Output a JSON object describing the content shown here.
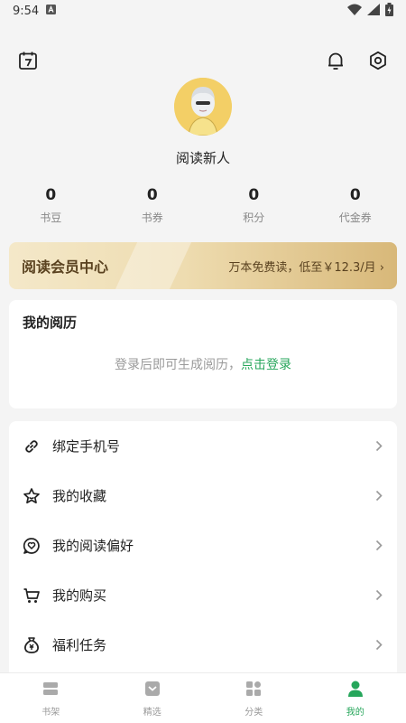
{
  "status_bar": {
    "time": "9:54"
  },
  "profile": {
    "nickname": "阅读新人"
  },
  "stats": [
    {
      "value": "0",
      "label": "书豆"
    },
    {
      "value": "0",
      "label": "书券"
    },
    {
      "value": "0",
      "label": "积分"
    },
    {
      "value": "0",
      "label": "代金券"
    }
  ],
  "vip": {
    "title": "阅读会员中心",
    "subtitle": "万本免费读，低至￥12.3/月 ›"
  },
  "history": {
    "title": "我的阅历",
    "tip": "登录后即可生成阅历，",
    "login_link": "点击登录"
  },
  "menu": [
    {
      "label": "绑定手机号",
      "icon": "link-icon"
    },
    {
      "label": "我的收藏",
      "icon": "star-icon"
    },
    {
      "label": "我的阅读偏好",
      "icon": "heart-chat-icon"
    },
    {
      "label": "我的购买",
      "icon": "cart-icon"
    },
    {
      "label": "福利任务",
      "icon": "money-bag-icon"
    }
  ],
  "tabs": [
    {
      "label": "书架",
      "icon": "bookshelf-icon"
    },
    {
      "label": "精选",
      "icon": "featured-icon"
    },
    {
      "label": "分类",
      "icon": "category-icon"
    },
    {
      "label": "我的",
      "icon": "profile-icon",
      "active": true
    }
  ],
  "colors": {
    "accent": "#26a65b",
    "vip_text": "#5a4220"
  }
}
